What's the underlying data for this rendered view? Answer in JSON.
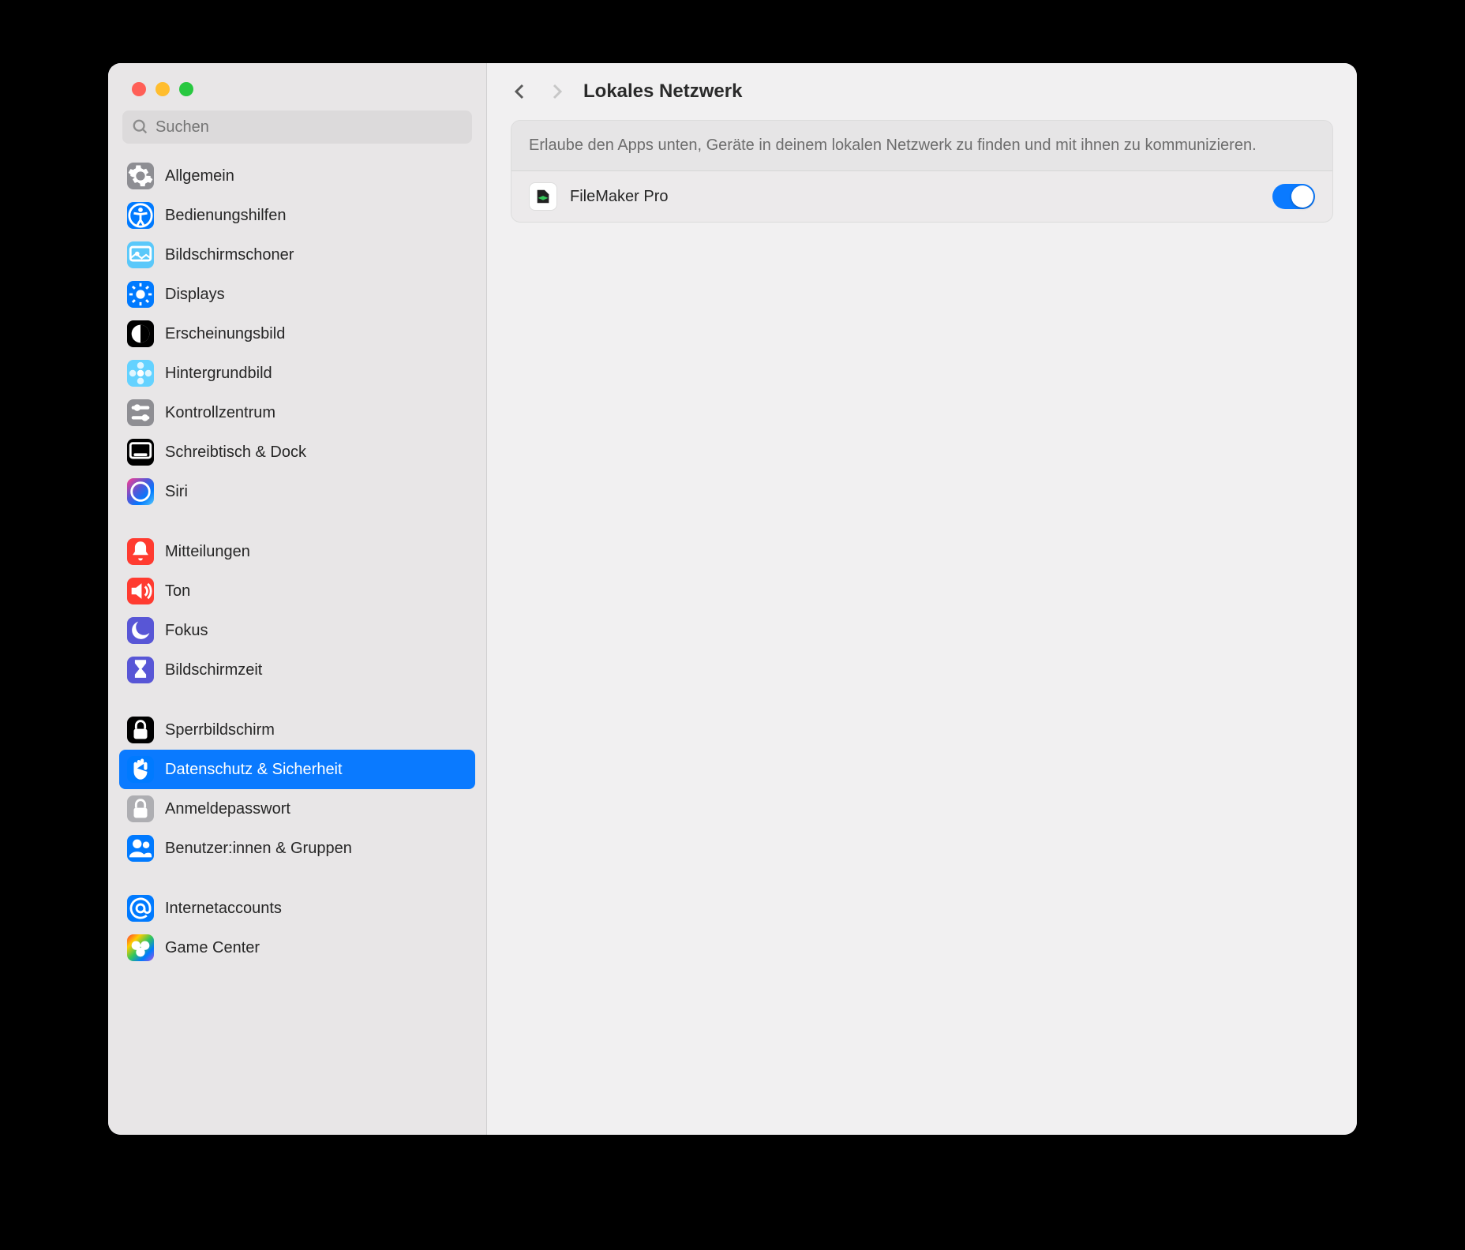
{
  "search": {
    "placeholder": "Suchen"
  },
  "header": {
    "title": "Lokales Netzwerk"
  },
  "description": "Erlaube den Apps unten, Geräte in deinem lokalen Netzwerk zu finden und mit ihnen zu kommunizieren.",
  "app_row": {
    "name": "FileMaker Pro",
    "enabled": true
  },
  "sidebar": {
    "groups": [
      [
        {
          "id": "allgemein",
          "label": "Allgemein",
          "icon": "gear",
          "bg": "bg-gray"
        },
        {
          "id": "bedienungshilfen",
          "label": "Bedienungshilfen",
          "icon": "accessibility",
          "bg": "bg-blue"
        },
        {
          "id": "bildschirmschoner",
          "label": "Bildschirmschoner",
          "icon": "screensaver",
          "bg": "bg-cyan"
        },
        {
          "id": "displays",
          "label": "Displays",
          "icon": "sun",
          "bg": "bg-blue"
        },
        {
          "id": "erscheinungsbild",
          "label": "Erscheinungsbild",
          "icon": "appearance",
          "bg": "bg-black"
        },
        {
          "id": "hintergrundbild",
          "label": "Hintergrundbild",
          "icon": "flower",
          "bg": "bg-lightblue"
        },
        {
          "id": "kontrollzentrum",
          "label": "Kontrollzentrum",
          "icon": "sliders",
          "bg": "bg-gray"
        },
        {
          "id": "schreibtisch-dock",
          "label": "Schreibtisch & Dock",
          "icon": "dock",
          "bg": "bg-black"
        },
        {
          "id": "siri",
          "label": "Siri",
          "icon": "siri",
          "bg": "bg-siri"
        }
      ],
      [
        {
          "id": "mitteilungen",
          "label": "Mitteilungen",
          "icon": "bell",
          "bg": "bg-red"
        },
        {
          "id": "ton",
          "label": "Ton",
          "icon": "speaker",
          "bg": "bg-red"
        },
        {
          "id": "fokus",
          "label": "Fokus",
          "icon": "moon",
          "bg": "bg-indigo"
        },
        {
          "id": "bildschirmzeit",
          "label": "Bildschirmzeit",
          "icon": "hourglass",
          "bg": "bg-indigo"
        }
      ],
      [
        {
          "id": "sperrbildschirm",
          "label": "Sperrbildschirm",
          "icon": "lock",
          "bg": "bg-black"
        },
        {
          "id": "datenschutz-sicherheit",
          "label": "Datenschutz & Sicherheit",
          "icon": "hand",
          "bg": "bg-blue",
          "selected": true
        },
        {
          "id": "anmeldepasswort",
          "label": "Anmeldepasswort",
          "icon": "padlock",
          "bg": "bg-gray2"
        },
        {
          "id": "benutzer-gruppen",
          "label": "Benutzer:innen & Gruppen",
          "icon": "users",
          "bg": "bg-blue"
        }
      ],
      [
        {
          "id": "internetaccounts",
          "label": "Internetaccounts",
          "icon": "at",
          "bg": "bg-blue"
        },
        {
          "id": "game-center",
          "label": "Game Center",
          "icon": "game",
          "bg": "bg-multicolor"
        }
      ]
    ]
  }
}
